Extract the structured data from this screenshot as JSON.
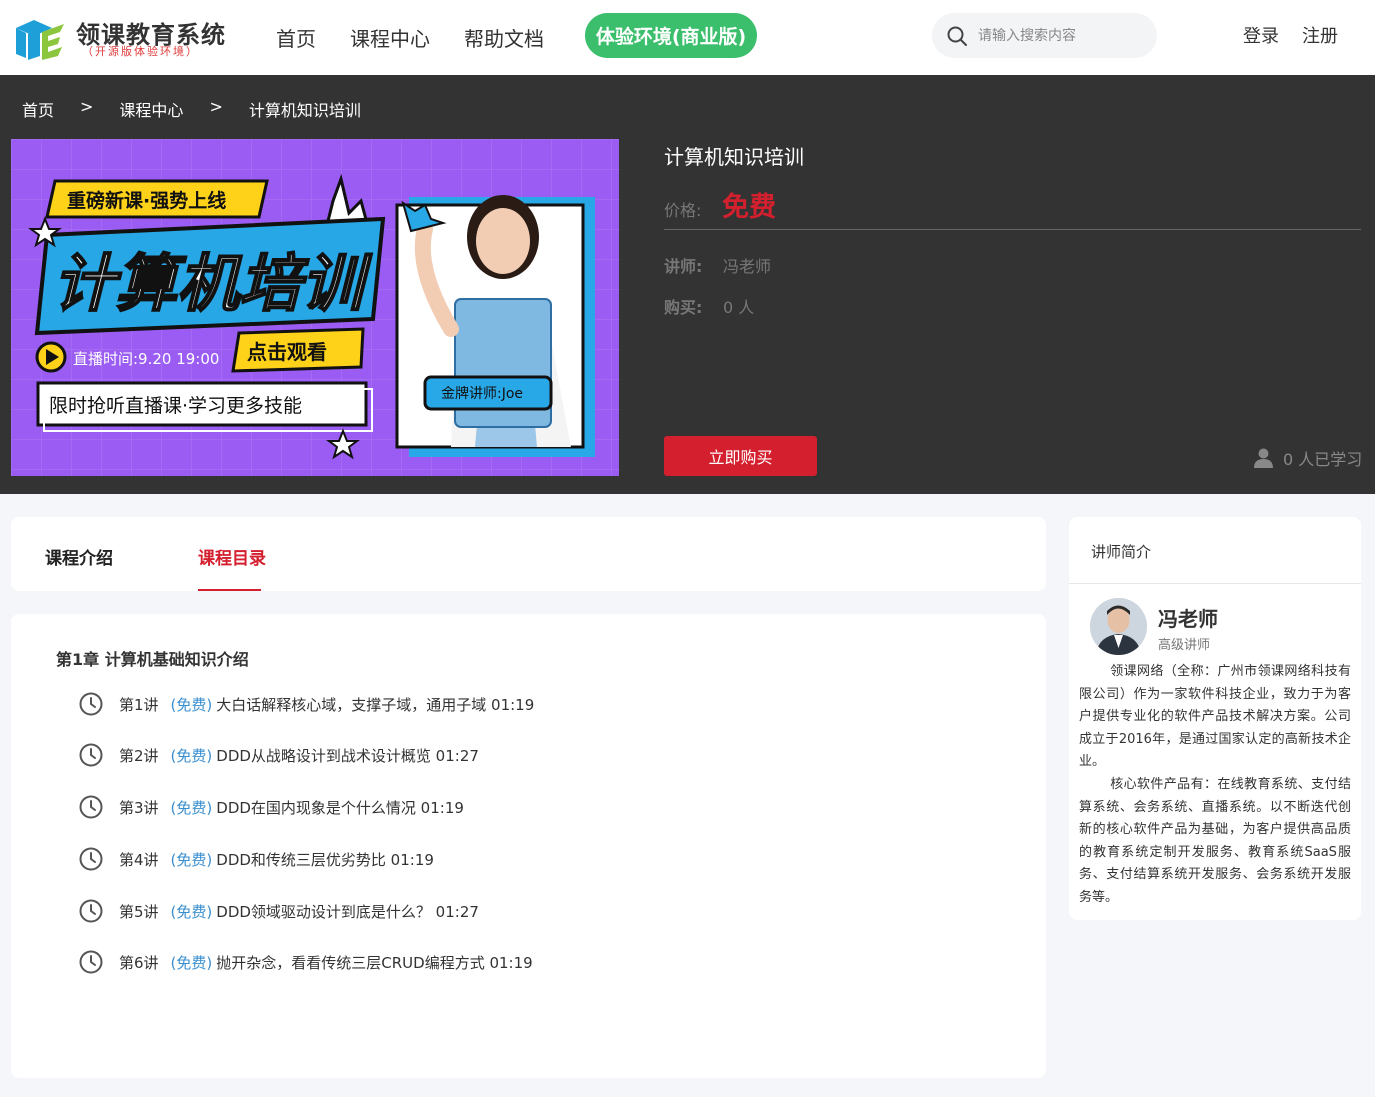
{
  "header": {
    "logo_title": "领课教育系统",
    "logo_subtitle": "（开源版体验环境）",
    "nav": [
      "首页",
      "课程中心",
      "帮助文档"
    ],
    "cta": "体验环境(商业版)",
    "search_placeholder": "请输入搜索内容",
    "login": "登录",
    "register": "注册"
  },
  "breadcrumb": [
    "首页",
    ">",
    "课程中心",
    ">",
    "计算机知识培训"
  ],
  "banner": {
    "tag": "重磅新课·强势上线",
    "headline": "计算机培训",
    "live_time": "直播时间:9.20 19:00",
    "watch": "点击观看",
    "slogan": "限时抢听直播课·学习更多技能",
    "teacher_badge": "金牌讲师:Joe"
  },
  "course": {
    "title": "计算机知识培训",
    "price_label": "价格:",
    "price": "免费",
    "teacher_label": "讲师:",
    "teacher": "冯老师",
    "buyers_label": "购买:",
    "buyers": "0 人",
    "buy_button": "立即购买",
    "learners": "0 人已学习"
  },
  "tabs": [
    "课程介绍",
    "课程目录"
  ],
  "catalog": {
    "chapter": "第1章  计算机基础知识介绍",
    "lessons": [
      {
        "num": "第1讲",
        "tag": "(免费)",
        "title": "大白话解释核心域，支撑子域，通用子域 01:19"
      },
      {
        "num": "第2讲",
        "tag": "(免费)",
        "title": "DDD从战略设计到战术设计概览 01:27"
      },
      {
        "num": "第3讲",
        "tag": "(免费)",
        "title": "DDD在国内现象是个什么情况 01:19"
      },
      {
        "num": "第4讲",
        "tag": "(免费)",
        "title": "DDD和传统三层优劣势比 01:19"
      },
      {
        "num": "第5讲",
        "tag": "(免费)",
        "title": "DDD领域驱动设计到底是什么？ 01:27"
      },
      {
        "num": "第6讲",
        "tag": "(免费)",
        "title": "抛开杂念，看看传统三层CRUD编程方式 01:19"
      }
    ]
  },
  "teacher_card": {
    "heading": "讲师简介",
    "name": "冯老师",
    "title": "高级讲师",
    "bio_1": "领课网络（全称：广州市领课网络科技有限公司）作为一家软件科技企业，致力于为客户提供专业化的软件产品技术解决方案。公司成立于2016年，是通过国家认定的高新技术企业。",
    "bio_2": "核心软件产品有：在线教育系统、支付结算系统、会务系统、直播系统。以不断迭代创新的核心软件产品为基础，为客户提供高品质的教育系统定制开发服务、教育系统SaaS服务、支付结算系统开发服务、会务系统开发服务等。"
  },
  "colors": {
    "brand_red": "#d4202e",
    "cta_green": "#3cbf6c",
    "hero_bg": "#333333",
    "link_blue": "#3a8fd0"
  }
}
